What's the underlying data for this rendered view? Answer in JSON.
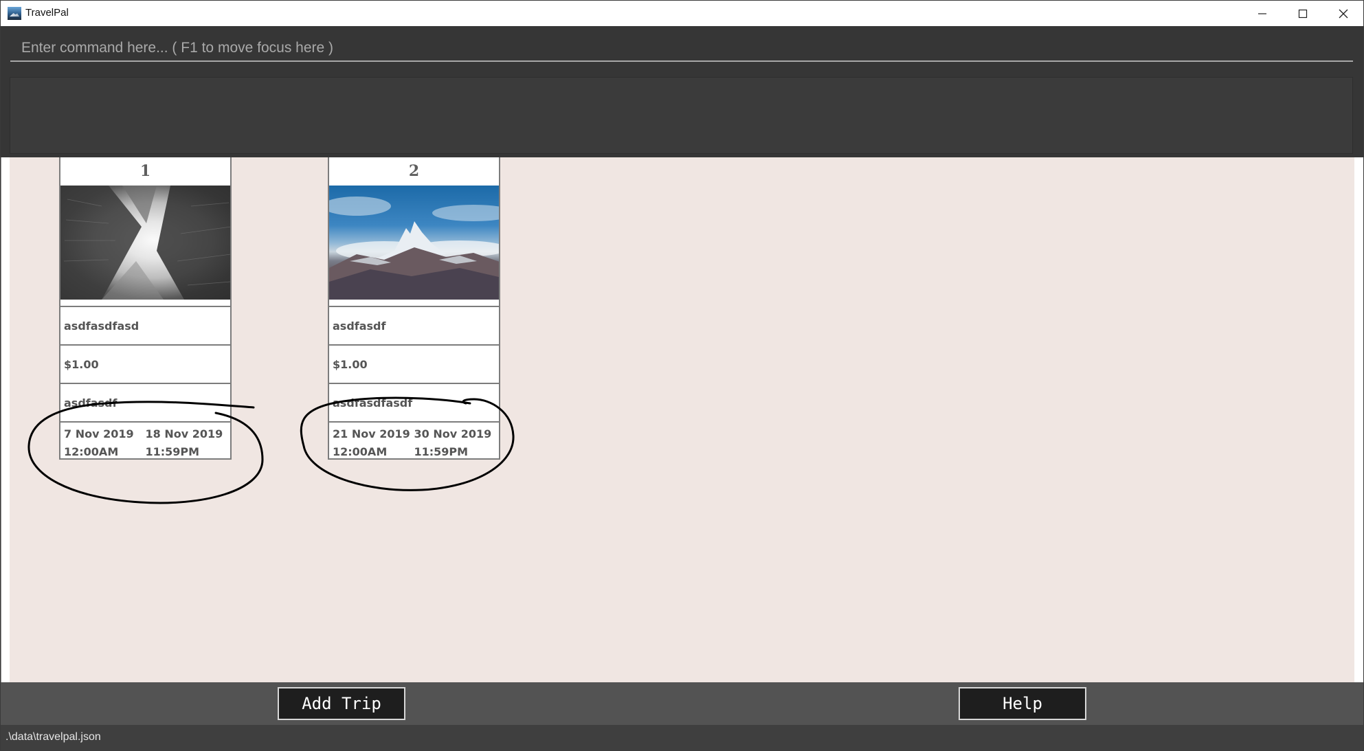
{
  "window": {
    "title": "TravelPal",
    "controls": [
      "minimize-icon",
      "maximize-icon",
      "close-icon"
    ]
  },
  "command": {
    "placeholder": "Enter command here... ( F1 to move focus here )",
    "value": ""
  },
  "result_display": {
    "text": ""
  },
  "trips": [
    {
      "index": "1",
      "image": "city-skyscrapers-photo",
      "name": "asdfasdfasd",
      "budget": "$1.00",
      "destination": "asdfasdf",
      "start_date": "7 Nov 2019",
      "start_time": "12:00AM",
      "end_date": "18 Nov 2019",
      "end_time": "11:59PM"
    },
    {
      "index": "2",
      "image": "snowy-mountain-photo",
      "name": "asdfasdf",
      "budget": "$1.00",
      "destination": "asdfasdfasdf",
      "start_date": "21 Nov 2019",
      "start_time": "12:00AM",
      "end_date": "30 Nov 2019",
      "end_time": "11:59PM"
    }
  ],
  "buttons": {
    "add_trip": "Add Trip",
    "help": "Help"
  },
  "status_bar": {
    "file_path": ".\\data\\travelpal.json"
  },
  "colors": {
    "dark_bg": "#363636",
    "list_bg": "#f0e6e2",
    "button_bg": "#1e1e1e",
    "bottom_bar": "#535353",
    "annotation_ink": "#000000"
  }
}
